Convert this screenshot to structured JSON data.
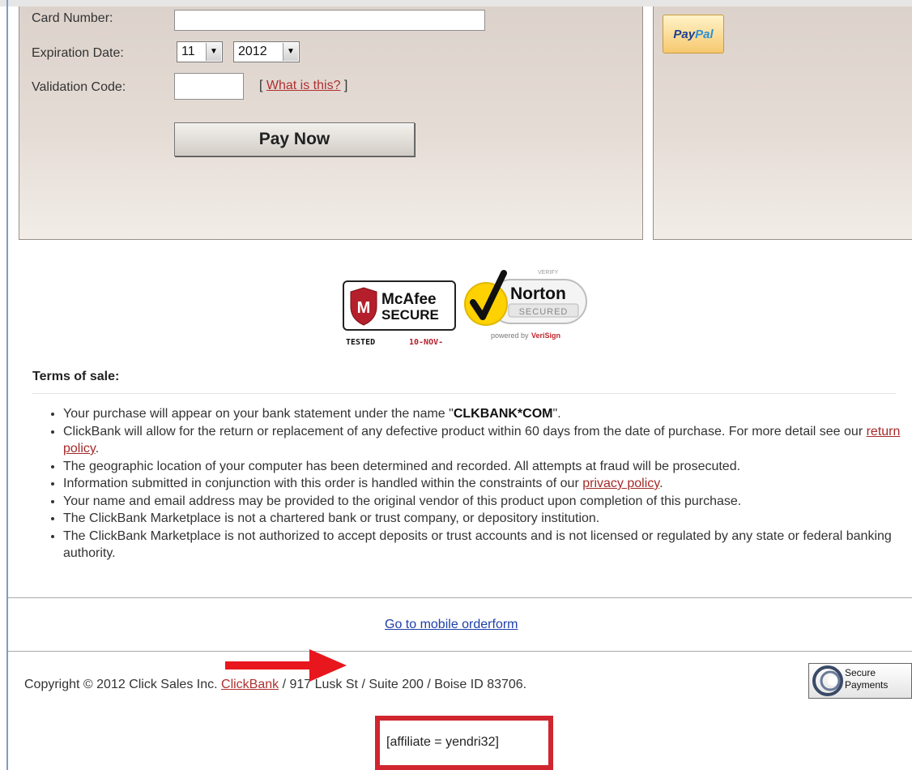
{
  "payment_form": {
    "card_number_label": "Card Number:",
    "card_number_value": "",
    "expiration_label": "Expiration Date:",
    "exp_month": "11",
    "exp_year": "2012",
    "validation_label": "Validation Code:",
    "validation_value": "",
    "what_is_this_prefix": "[ ",
    "what_is_this_link": "What is this?",
    "what_is_this_suffix": " ]",
    "pay_button": "Pay Now"
  },
  "side": {
    "paypal_pay": "Pay",
    "paypal_pal": "Pal"
  },
  "badges": {
    "mcafee_name": "McAfee",
    "mcafee_secure": "SECURE",
    "mcafee_tested": "TESTED",
    "mcafee_date": "10-NOV-",
    "norton_verify": "VERIFY",
    "norton_name": "Norton",
    "norton_secured": "SECURED",
    "norton_powered": "powered by",
    "norton_verisign": "VeriSign"
  },
  "terms": {
    "title": "Terms of sale:",
    "items": {
      "i1_pre": "Your purchase will appear on your bank statement under the name \"",
      "i1_bold": "CLKBANK*COM",
      "i1_post": "\".",
      "i2_pre": "ClickBank will allow for the return or replacement of any defective product within 60 days from the date of purchase. For more detail see our ",
      "i2_link": "return policy",
      "i2_post": ".",
      "i3": "The geographic location of your computer has been determined and recorded. All attempts at fraud will be prosecuted.",
      "i4_pre": "Information submitted in conjunction with this order is handled within the constraints of our ",
      "i4_link": "privacy policy",
      "i4_post": ".",
      "i5": "Your name and email address may be provided to the original vendor of this product upon completion of this purchase.",
      "i6": "The ClickBank Marketplace is not a chartered bank or trust company, or depository institution.",
      "i7": "The ClickBank Marketplace is not authorized to accept deposits or trust accounts and is not licensed or regulated by any state or federal banking authority."
    }
  },
  "footer": {
    "mobile_link": "Go to mobile orderform",
    "copyright_pre": "Copyright © 2012 Click Sales Inc. ",
    "copyright_link": "ClickBank",
    "copyright_post": " / 917 Lusk St / Suite 200 / Boise ID 83706.",
    "secure_line1": "Secure",
    "secure_line2": "Payments"
  },
  "annotation": {
    "affiliate_text": "[affiliate = yendri32]",
    "arrow_color": "#e8161d",
    "box_color": "#d0262f"
  }
}
